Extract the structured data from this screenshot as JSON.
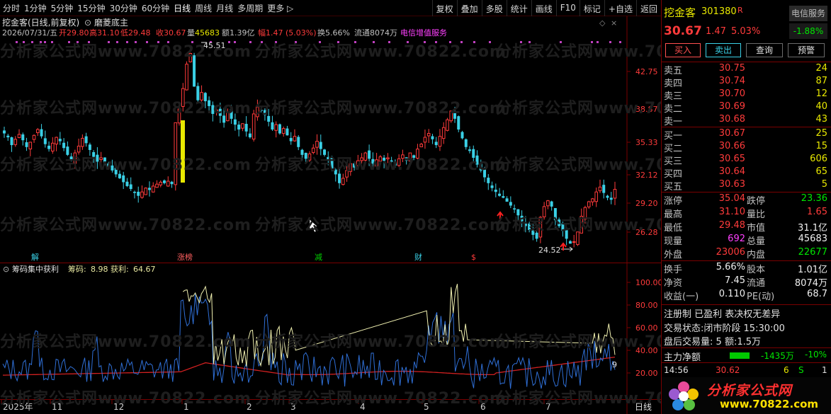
{
  "toolbar": {
    "items": [
      "分时",
      "1分钟",
      "5分钟",
      "15分钟",
      "30分钟",
      "60分钟",
      "日线",
      "周线",
      "月线",
      "多周期",
      "更多 ▷"
    ],
    "right_items": [
      "复权",
      "叠加",
      "多股",
      "统计",
      "画线",
      "F10",
      "标记",
      "+自选",
      "返回"
    ]
  },
  "main": {
    "title": "挖金客(日线,前复权)",
    "indicator": "磨菱底主",
    "info_date": "2026/07/31/五",
    "info_open_label": "开",
    "info_open": "29.80",
    "info_high_label": "高",
    "info_high": "31.10",
    "info_low_label": "低",
    "info_low": "29.48",
    "info_close_label": "收",
    "info_close": "30.67",
    "info_vol_label": "量",
    "info_vol": "45683",
    "info_amt_label": "额",
    "info_amt": "1.39亿",
    "info_chg_label": "幅",
    "info_chg": "1.47 (5.03%)",
    "info_turn": "换5.66%",
    "info_float": "流通8074万",
    "info_sector": "电信增值服务",
    "y_ticks": [
      "42.75",
      "38.87",
      "35.33",
      "32.12",
      "29.20",
      "26.28"
    ],
    "peak_label": "45.51",
    "trough_label": "24.52",
    "event_labels": [
      "解",
      "涨榜",
      "减",
      "财",
      "$"
    ]
  },
  "sub": {
    "title": "筹码集中获利",
    "chip_label": "筹码:",
    "chip_value": "8.98",
    "profit_label": "获利:",
    "profit_value": "64.67",
    "y_ticks": [
      "100.00",
      "80.00",
      "60.00",
      "40.00",
      "20.00"
    ],
    "end_label": "9"
  },
  "xaxis": {
    "labels": [
      "2025年",
      "11",
      "12",
      "1",
      "2",
      "3",
      "4",
      "5",
      "6",
      "7"
    ],
    "period": "日线"
  },
  "quote": {
    "name": "挖金客",
    "code": "301380",
    "flag": "R",
    "sector_badge": "电信服务",
    "price": "30.67",
    "change": "1.47",
    "change_pct": "5.03%",
    "sector_change": "-1.88%",
    "buttons": [
      "买入",
      "卖出",
      "查询",
      "预警"
    ],
    "asks": [
      {
        "label": "卖五",
        "price": "30.75",
        "vol": "24"
      },
      {
        "label": "卖四",
        "price": "30.74",
        "vol": "87"
      },
      {
        "label": "卖三",
        "price": "30.70",
        "vol": "12"
      },
      {
        "label": "卖二",
        "price": "30.69",
        "vol": "40"
      },
      {
        "label": "卖一",
        "price": "30.68",
        "vol": "43"
      }
    ],
    "bids": [
      {
        "label": "买一",
        "price": "30.67",
        "vol": "25"
      },
      {
        "label": "买二",
        "price": "30.66",
        "vol": "15"
      },
      {
        "label": "买三",
        "price": "30.65",
        "vol": "606"
      },
      {
        "label": "买四",
        "price": "30.64",
        "vol": "65"
      },
      {
        "label": "买五",
        "price": "30.63",
        "vol": "5"
      }
    ],
    "stats": [
      {
        "l1": "涨停",
        "v1": "35.04",
        "l2": "跌停",
        "v2": "23.36",
        "c1": "red",
        "c2": "green"
      },
      {
        "l1": "最高",
        "v1": "31.10",
        "l2": "量比",
        "v2": "1.65",
        "c1": "red",
        "c2": "red"
      },
      {
        "l1": "最低",
        "v1": "29.48",
        "l2": "市值",
        "v2": "31.1亿",
        "c1": "red",
        "c2": "white"
      },
      {
        "l1": "现量",
        "v1": "692",
        "l2": "总量",
        "v2": "45683",
        "c1": "magenta",
        "c2": "white"
      },
      {
        "l1": "外盘",
        "v1": "23006",
        "l2": "内盘",
        "v2": "22677",
        "c1": "red",
        "c2": "green"
      }
    ],
    "fundamentals": [
      {
        "l1": "换手",
        "v1": "5.66%",
        "l2": "股本",
        "v2": "1.01亿"
      },
      {
        "l1": "净资",
        "v1": "7.45",
        "l2": "流通",
        "v2": "8074万"
      },
      {
        "l1": "收益(一)",
        "v1": "0.110",
        "l2": "PE(动)",
        "v2": "68.7"
      }
    ],
    "reg_line": "注册制 已盈利 表决权无差异",
    "trade_status_label": "交易状态:",
    "trade_status": "闭市阶段 15:30:00",
    "after_hours_label": "盘后交易量:",
    "after_hours_vol": "5",
    "after_hours_amt_label": "额:",
    "after_hours_amt": "1.5万",
    "main_flow_label": "主力净额",
    "main_flow_value": "-1435万",
    "main_flow_pct": "-10%",
    "last_tick_time": "14:56",
    "last_tick_price": "30.62",
    "last_tick_vol": "6",
    "last_tick_side": "S",
    "last_tick_count": "1"
  },
  "brand": {
    "name": "分析家公式网",
    "url": "www.70822.com"
  },
  "watermark": "分析家公式网www.70822.com",
  "colors": {
    "up": "#ff3b3b",
    "down": "#3ad0e6",
    "accent_yellow": "#e8e800",
    "grid": "#7a0000"
  },
  "chart_data": [
    {
      "type": "candlestick",
      "title": "挖金客(日线,前复权)",
      "ylim": [
        24.5,
        45.5
      ],
      "y_ticks": [
        42.75,
        38.87,
        35.33,
        32.12,
        29.2,
        26.28
      ],
      "close": [
        36.4,
        36.0,
        35.2,
        35.8,
        36.3,
        35.7,
        35.0,
        35.5,
        36.2,
        36.8,
        36.1,
        35.3,
        34.8,
        35.4,
        36.0,
        35.6,
        34.9,
        34.2,
        33.6,
        34.4,
        35.1,
        35.9,
        35.4,
        34.7,
        34.0,
        33.5,
        33.9,
        33.4,
        33.0,
        32.6,
        32.2,
        31.8,
        31.4,
        31.0,
        30.7,
        30.3,
        30.0,
        30.4,
        30.8,
        30.6,
        31.0,
        31.2,
        31.4,
        31.3,
        31.5,
        31.2,
        37.5,
        38.9,
        41.0,
        43.5,
        44.6,
        41.2,
        39.8,
        40.6,
        39.7,
        39.2,
        38.4,
        38.8,
        38.2,
        37.5,
        38.6,
        37.9,
        37.3,
        36.8,
        37.4,
        36.6,
        36.0,
        38.4,
        39.1,
        38.7,
        38.3,
        37.6,
        36.8,
        37.3,
        36.4,
        36.9,
        36.2,
        35.6,
        36.1,
        35.0,
        34.2,
        33.8,
        34.3,
        34.9,
        35.6,
        34.8,
        34.2,
        33.6,
        32.8,
        32.2,
        31.3,
        31.8,
        32.6,
        33.3,
        32.9,
        33.6,
        33.9,
        34.4,
        33.8,
        33.3,
        33.7,
        34.0,
        33.6,
        33.9,
        33.5,
        33.1,
        33.8,
        34.2,
        33.6,
        34.4,
        33.9,
        34.8,
        35.3,
        36.0,
        36.4,
        35.8,
        35.2,
        36.1,
        37.0,
        37.8,
        38.7,
        37.9,
        36.8,
        35.9,
        35.0,
        34.6,
        33.9,
        33.2,
        32.6,
        31.9,
        31.3,
        30.8,
        30.4,
        30.0,
        29.8,
        29.4,
        29.0,
        28.6,
        28.0,
        27.4,
        26.9,
        26.5,
        26.0,
        25.6,
        27.8,
        28.9,
        29.5,
        28.9,
        27.5,
        26.9,
        26.4,
        25.6,
        25.1,
        25.3,
        26.3,
        27.9,
        28.8,
        29.4,
        29.7,
        30.4,
        30.9,
        30.3,
        29.8,
        29.6,
        30.67
      ],
      "events": [
        "解",
        "涨榜",
        "减",
        "财",
        "$"
      ]
    },
    {
      "type": "line",
      "title": "筹码集中获利",
      "ylim": [
        0,
        105
      ],
      "y_ticks": [
        100,
        80,
        60,
        40,
        20
      ],
      "series": [
        {
          "name": "筹码",
          "latest": 8.98
        },
        {
          "name": "获利",
          "latest": 64.67
        }
      ]
    }
  ]
}
